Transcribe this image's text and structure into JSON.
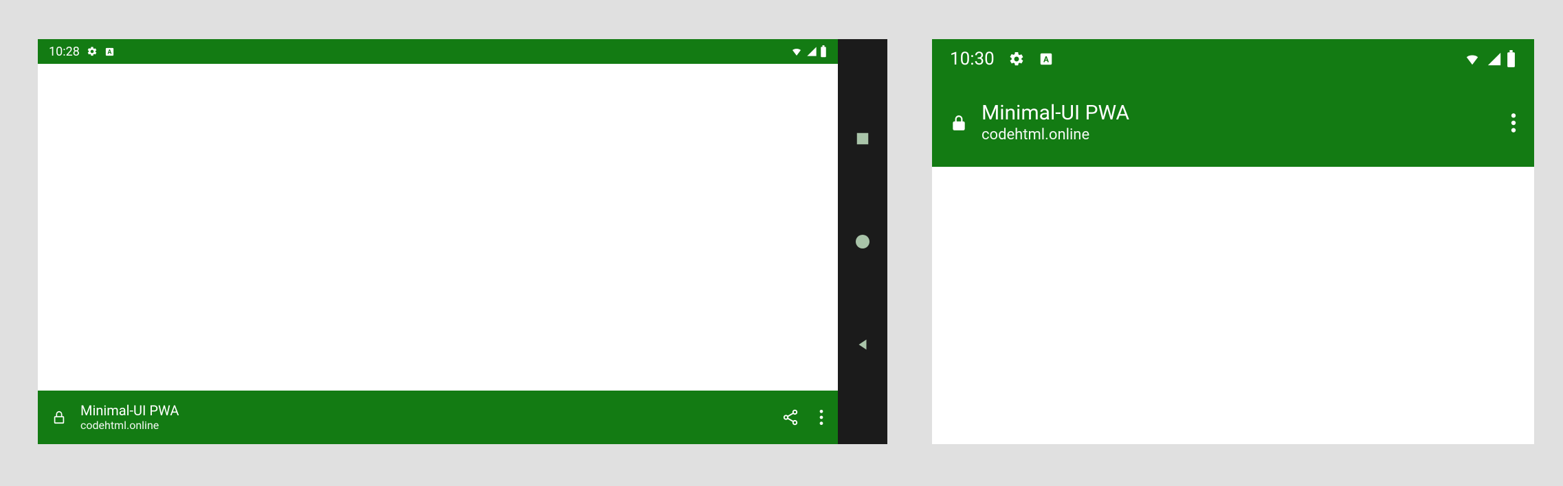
{
  "colors": {
    "theme": "#137b13",
    "navbar": "#1b1b1b",
    "navkey": "#a9c4a9",
    "page_bg": "#e0e0e0"
  },
  "device1": {
    "status": {
      "time": "10:28"
    },
    "app": {
      "title": "Minimal-UI PWA",
      "subtitle": "codehtml.online"
    }
  },
  "device2": {
    "status": {
      "time": "10:30"
    },
    "app": {
      "title": "Minimal-UI PWA",
      "subtitle": "codehtml.online"
    }
  }
}
